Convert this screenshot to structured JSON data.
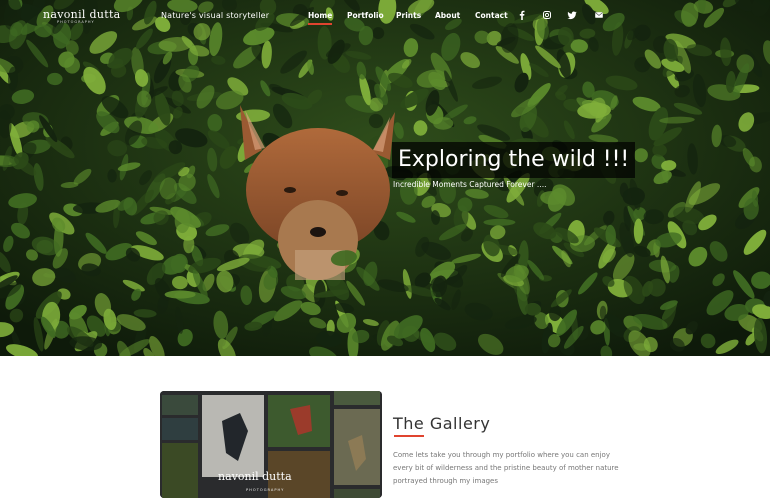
{
  "brand": {
    "logo_text": "navonil dutta",
    "logo_subtext": "PHOTOGRAPHY",
    "tagline": "Nature's visual storyteller"
  },
  "nav": {
    "items": [
      {
        "label": "Home",
        "active": true
      },
      {
        "label": "Portfolio",
        "active": false
      },
      {
        "label": "Prints",
        "active": false
      },
      {
        "label": "About",
        "active": false
      },
      {
        "label": "Contact",
        "active": false
      }
    ]
  },
  "social": [
    "facebook-icon",
    "instagram-icon",
    "twitter-icon",
    "email-icon"
  ],
  "hero": {
    "title": "Exploring the wild !!!",
    "subtitle": "Incredible Moments Captured Forever ...."
  },
  "gallery": {
    "title": "The Gallery",
    "description": "Come lets take you through my portfolio where you can enjoy every bit of wilderness and the pristine beauty of mother nature portrayed through my images",
    "image_logo_text": "navonil dutta",
    "image_logo_subtext": "PHOTOGRAPHY"
  },
  "colors": {
    "accent": "#e0442f",
    "foliage_dark": "#14240f",
    "foliage_mid": "#3f6a22",
    "foliage_light": "#7fae3a"
  }
}
